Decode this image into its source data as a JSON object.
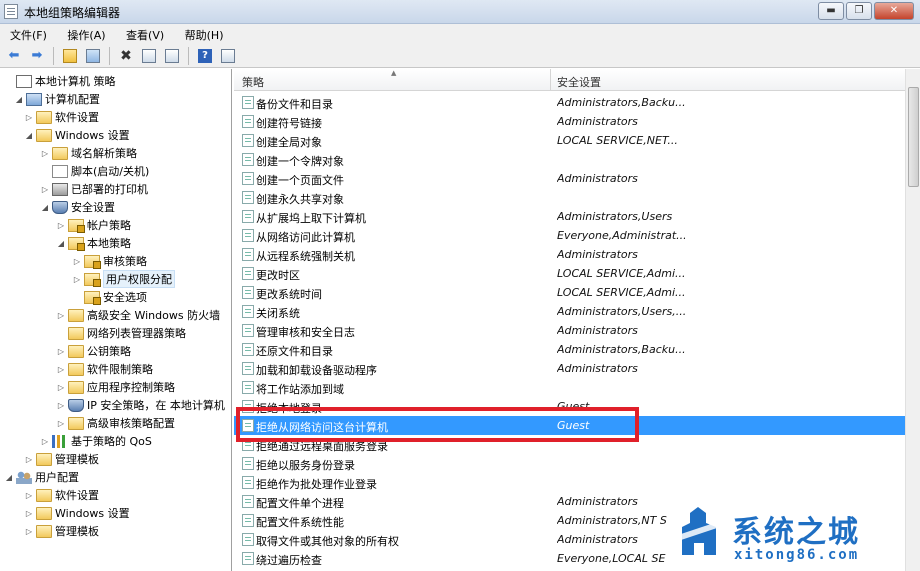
{
  "window": {
    "title": "本地组策略编辑器",
    "buttons": {
      "minimize": "▬",
      "maximize": "❐",
      "close": "✕"
    }
  },
  "menu": [
    "文件(F)",
    "操作(A)",
    "查看(V)",
    "帮助(H)"
  ],
  "toolbar": {
    "help_label": "?"
  },
  "tree": [
    {
      "label": "本地计算机 策略",
      "icon": "gpo-icon",
      "arrow": ""
    },
    {
      "label": "计算机配置",
      "icon": "computer-icon",
      "arrow": "◢"
    },
    {
      "label": "软件设置",
      "icon": "folder-icon",
      "arrow": "▷"
    },
    {
      "label": "Windows 设置",
      "icon": "folder-icon",
      "arrow": "◢"
    },
    {
      "label": "域名解析策略",
      "icon": "folder-icon",
      "arrow": "▷"
    },
    {
      "label": "脚本(启动/关机)",
      "icon": "script-icon",
      "arrow": ""
    },
    {
      "label": "已部署的打印机",
      "icon": "printer-icon",
      "arrow": "▷"
    },
    {
      "label": "安全设置",
      "icon": "shield-icon",
      "arrow": "◢"
    },
    {
      "label": "帐户策略",
      "icon": "lock-folder-icon",
      "arrow": "▷"
    },
    {
      "label": "本地策略",
      "icon": "lock-folder-icon",
      "arrow": "◢"
    },
    {
      "label": "审核策略",
      "icon": "lock-folder-icon",
      "arrow": "▷"
    },
    {
      "label": "用户权限分配",
      "icon": "lock-folder-icon",
      "arrow": "▷"
    },
    {
      "label": "安全选项",
      "icon": "lock-folder-icon",
      "arrow": ""
    },
    {
      "label": "高级安全 Windows 防火墙",
      "icon": "folder-icon",
      "arrow": "▷"
    },
    {
      "label": "网络列表管理器策略",
      "icon": "folder-icon",
      "arrow": ""
    },
    {
      "label": "公钥策略",
      "icon": "folder-icon",
      "arrow": "▷"
    },
    {
      "label": "软件限制策略",
      "icon": "folder-icon",
      "arrow": "▷"
    },
    {
      "label": "应用程序控制策略",
      "icon": "folder-icon",
      "arrow": "▷"
    },
    {
      "label": "IP 安全策略，在 本地计算机",
      "icon": "shield-icon",
      "arrow": "▷"
    },
    {
      "label": "高级审核策略配置",
      "icon": "folder-icon",
      "arrow": "▷"
    },
    {
      "label": "基于策略的 QoS",
      "icon": "chart-icon",
      "arrow": "▷"
    },
    {
      "label": "管理模板",
      "icon": "folder-icon",
      "arrow": "▷"
    },
    {
      "label": "用户配置",
      "icon": "users-icon",
      "arrow": "◢"
    },
    {
      "label": "软件设置",
      "icon": "folder-icon",
      "arrow": "▷"
    },
    {
      "label": "Windows 设置",
      "icon": "folder-icon",
      "arrow": "▷"
    },
    {
      "label": "管理模板",
      "icon": "folder-icon",
      "arrow": "▷"
    }
  ],
  "list": {
    "headers": {
      "policy": "策略",
      "security": "安全设置"
    },
    "rows": [
      {
        "policy": "备份文件和目录",
        "value": "Administrators,Backu..."
      },
      {
        "policy": "创建符号链接",
        "value": "Administrators"
      },
      {
        "policy": "创建全局对象",
        "value": "LOCAL SERVICE,NET..."
      },
      {
        "policy": "创建一个令牌对象",
        "value": ""
      },
      {
        "policy": "创建一个页面文件",
        "value": "Administrators"
      },
      {
        "policy": "创建永久共享对象",
        "value": ""
      },
      {
        "policy": "从扩展坞上取下计算机",
        "value": "Administrators,Users"
      },
      {
        "policy": "从网络访问此计算机",
        "value": "Everyone,Administrat..."
      },
      {
        "policy": "从远程系统强制关机",
        "value": "Administrators"
      },
      {
        "policy": "更改时区",
        "value": "LOCAL SERVICE,Admi..."
      },
      {
        "policy": "更改系统时间",
        "value": "LOCAL SERVICE,Admi..."
      },
      {
        "policy": "关闭系统",
        "value": "Administrators,Users,..."
      },
      {
        "policy": "管理审核和安全日志",
        "value": "Administrators"
      },
      {
        "policy": "还原文件和目录",
        "value": "Administrators,Backu..."
      },
      {
        "policy": "加载和卸载设备驱动程序",
        "value": "Administrators"
      },
      {
        "policy": "将工作站添加到域",
        "value": ""
      },
      {
        "policy": "拒绝本地登录",
        "value": "Guest"
      },
      {
        "policy": "拒绝从网络访问这台计算机",
        "value": "Guest"
      },
      {
        "policy": "拒绝通过远程桌面服务登录",
        "value": ""
      },
      {
        "policy": "拒绝以服务身份登录",
        "value": ""
      },
      {
        "policy": "拒绝作为批处理作业登录",
        "value": ""
      },
      {
        "policy": "配置文件单个进程",
        "value": "Administrators"
      },
      {
        "policy": "配置文件系统性能",
        "value": "Administrators,NT S"
      },
      {
        "policy": "取得文件或其他对象的所有权",
        "value": "Administrators"
      },
      {
        "policy": "绕过遍历检查",
        "value": "Everyone,LOCAL SE"
      }
    ]
  },
  "watermark": {
    "title": "系统之城",
    "url": "xitong86.com",
    "color": "#1f6fc3"
  }
}
